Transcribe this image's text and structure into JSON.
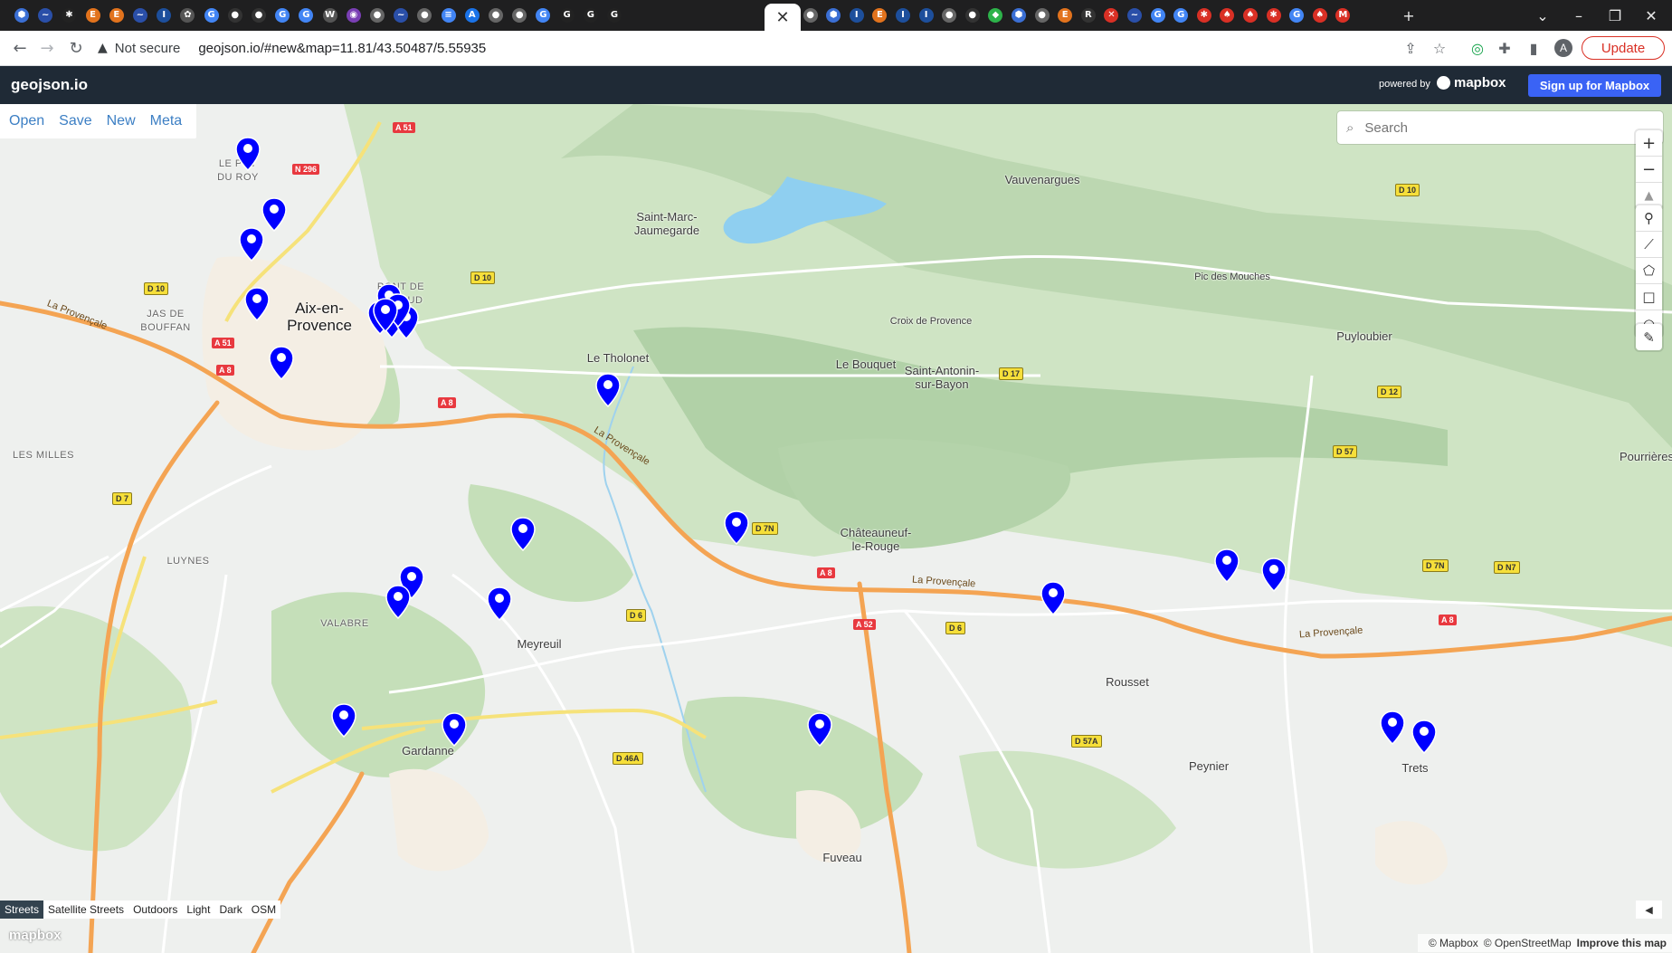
{
  "browser": {
    "tab_favicons": [
      {
        "glyph": "⬢",
        "color": "#3b6fd4"
      },
      {
        "glyph": "~",
        "color": "#2a4fa8"
      },
      {
        "glyph": "✱",
        "color": "#222"
      },
      {
        "glyph": "E",
        "color": "#e2731d"
      },
      {
        "glyph": "E",
        "color": "#e2731d"
      },
      {
        "glyph": "~",
        "color": "#2a4fa8"
      },
      {
        "glyph": "I",
        "color": "#1d4f9c"
      },
      {
        "glyph": "✿",
        "color": "#555"
      },
      {
        "glyph": "G",
        "color": "#4285f4"
      },
      {
        "glyph": "●",
        "color": "#333"
      },
      {
        "glyph": "●",
        "color": "#333"
      },
      {
        "glyph": "G",
        "color": "#4285f4"
      },
      {
        "glyph": "G",
        "color": "#4285f4"
      },
      {
        "glyph": "W",
        "color": "#555"
      },
      {
        "glyph": "◉",
        "color": "#7a3fb4"
      },
      {
        "glyph": "●",
        "color": "#666"
      },
      {
        "glyph": "~",
        "color": "#2a4fa8"
      },
      {
        "glyph": "●",
        "color": "#666"
      },
      {
        "glyph": "≡",
        "color": "#4285f4"
      },
      {
        "glyph": "A",
        "color": "#1a73e8"
      },
      {
        "glyph": "●",
        "color": "#666"
      },
      {
        "glyph": "●",
        "color": "#666"
      },
      {
        "glyph": "G",
        "color": "#4285f4"
      },
      {
        "glyph": "G",
        "color": "#222"
      },
      {
        "glyph": "G",
        "color": "#222"
      },
      {
        "glyph": "G",
        "color": "#222"
      }
    ],
    "tab_favicons_right": [
      {
        "glyph": "~",
        "color": "#2a4fa8"
      },
      {
        "glyph": "●",
        "color": "#666"
      },
      {
        "glyph": "⬢",
        "color": "#3b6fd4"
      },
      {
        "glyph": "I",
        "color": "#1d4f9c"
      },
      {
        "glyph": "E",
        "color": "#e2731d"
      },
      {
        "glyph": "I",
        "color": "#1d4f9c"
      },
      {
        "glyph": "I",
        "color": "#1d4f9c"
      },
      {
        "glyph": "●",
        "color": "#666"
      },
      {
        "glyph": "●",
        "color": "#333"
      },
      {
        "glyph": "◆",
        "color": "#2db34a"
      },
      {
        "glyph": "⬢",
        "color": "#3b6fd4"
      },
      {
        "glyph": "●",
        "color": "#666"
      },
      {
        "glyph": "E",
        "color": "#e2731d"
      },
      {
        "glyph": "R",
        "color": "#333"
      },
      {
        "glyph": "✕",
        "color": "#d93025"
      },
      {
        "glyph": "~",
        "color": "#2a4fa8"
      },
      {
        "glyph": "G",
        "color": "#4285f4"
      },
      {
        "glyph": "G",
        "color": "#4285f4"
      },
      {
        "glyph": "✱",
        "color": "#d93025"
      },
      {
        "glyph": "♠",
        "color": "#d93025"
      },
      {
        "glyph": "♠",
        "color": "#d93025"
      },
      {
        "glyph": "✱",
        "color": "#d93025"
      },
      {
        "glyph": "G",
        "color": "#4285f4"
      },
      {
        "glyph": "♠",
        "color": "#d93025"
      },
      {
        "glyph": "M",
        "color": "#d93025"
      }
    ],
    "active_tab_close": "✕",
    "new_tab": "+",
    "insecure_label": "Not secure",
    "url": "geojson.io/#new&map=11.81/43.50487/5.55935",
    "update_label": "Update",
    "avatar_initial": "A"
  },
  "app": {
    "brand": "geojson.io",
    "powered_by": "powered by",
    "mapbox_label": "mapbox",
    "signup_label": "Sign up for Mapbox",
    "menu": [
      "Open",
      "Save",
      "New",
      "Meta"
    ],
    "search_placeholder": "Search",
    "style_options": [
      "Streets",
      "Satellite Streets",
      "Outdoors",
      "Light",
      "Dark",
      "OSM"
    ],
    "active_style": "Streets",
    "watermark": "mapbox",
    "attribution": [
      "© Mapbox",
      "© OpenStreetMap",
      "Improve this map"
    ]
  },
  "map": {
    "places": [
      {
        "name": "Aix-en-\nProvence",
        "big": true
      },
      {
        "name": "LE PUY\nDU ROY",
        "caps": true
      },
      {
        "name": "JAS DE\nBOUFFAN",
        "caps": true
      },
      {
        "name": "PONT DE\nBÉRAUD",
        "caps": true
      },
      {
        "name": "LES MILLES",
        "caps": true
      },
      {
        "name": "LUYNES",
        "caps": true
      },
      {
        "name": "VALABRE",
        "caps": true
      },
      {
        "name": "Saint-Marc-\nJaumegarde"
      },
      {
        "name": "Vauvenargues"
      },
      {
        "name": "Le Tholonet"
      },
      {
        "name": "Le Bouquet"
      },
      {
        "name": "Saint-Antonin-\nsur-Bayon"
      },
      {
        "name": "Croix de Provence"
      },
      {
        "name": "Pic des Mouches"
      },
      {
        "name": "Puyloubier"
      },
      {
        "name": "Pourrières"
      },
      {
        "name": "Châteauneuf-\nle-Rouge"
      },
      {
        "name": "Meyreuil"
      },
      {
        "name": "Rousset"
      },
      {
        "name": "Gardanne"
      },
      {
        "name": "Fuveau"
      },
      {
        "name": "Peynier"
      },
      {
        "name": "Trets"
      }
    ],
    "shields": [
      {
        "ref": "A 51",
        "kind": "red"
      },
      {
        "ref": "N 296",
        "kind": "red"
      },
      {
        "ref": "A 51",
        "kind": "red"
      },
      {
        "ref": "A 8",
        "kind": "red"
      },
      {
        "ref": "A 8",
        "kind": "red"
      },
      {
        "ref": "A 8",
        "kind": "red"
      },
      {
        "ref": "A 52",
        "kind": "red"
      },
      {
        "ref": "A 8",
        "kind": "red"
      },
      {
        "ref": "D 10",
        "kind": "yel"
      },
      {
        "ref": "D 10",
        "kind": "yel"
      },
      {
        "ref": "D 10",
        "kind": "yel"
      },
      {
        "ref": "D 17",
        "kind": "yel"
      },
      {
        "ref": "D 12",
        "kind": "yel"
      },
      {
        "ref": "D 57",
        "kind": "yel"
      },
      {
        "ref": "D 7",
        "kind": "yel"
      },
      {
        "ref": "D 7N",
        "kind": "yel"
      },
      {
        "ref": "D 7N",
        "kind": "yel"
      },
      {
        "ref": "D N7",
        "kind": "yel"
      },
      {
        "ref": "D 6",
        "kind": "yel"
      },
      {
        "ref": "D 6",
        "kind": "yel"
      },
      {
        "ref": "D 46A",
        "kind": "yel"
      },
      {
        "ref": "D 57A",
        "kind": "yel"
      }
    ],
    "road_labels": [
      "La Provençale",
      "La Provençale",
      "La Provençale",
      "La Provençale"
    ],
    "marker_count": 28,
    "marker_color": "#0000ff"
  }
}
